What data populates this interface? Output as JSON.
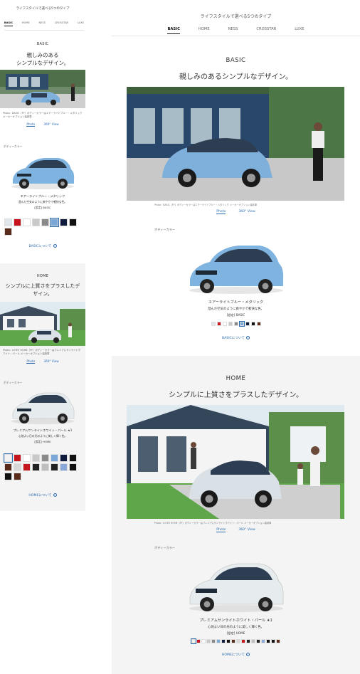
{
  "page_title": "ライフスタイルで選べる5つのタイプ",
  "tabs": [
    "BASIC",
    "HOME",
    "NESS",
    "CROSSTAR",
    "LUXE"
  ],
  "active_tab": "BASIC",
  "basic": {
    "type_label": "BASIC",
    "headline_mobile_line1": "親しみのある",
    "headline_mobile_line2": "シンプルなデザイン。",
    "headline": "親しみのあるシンプルなデザイン。",
    "photo_caption": "Photo：BASIC（FF）ボディーカラーはエアーライトブルー・メタリック メーカーオプション装着車",
    "link_photo": "Photo",
    "link_360": "360° View",
    "body_color_label": "ボディーカラー",
    "color_name": "エアーライトブルー・メタリック",
    "color_desc": "澄んだ空気のように爽やかで軽快な色。",
    "color_type": "[設定] BASIC",
    "more_link": "BASICについて",
    "swatches_mobile": [
      "#dfe6ec",
      "#c4161c",
      "#ffffff",
      "#c9c9c9",
      "#8a8a8a",
      "#7aa7d6",
      "#0e1b3d",
      "#111111",
      "#5a2a1a"
    ],
    "swatches_desktop": [
      "#dfe6ec",
      "#c4161c",
      "#ffffff",
      "#c9c9c9",
      "#8a8a8a",
      "#7aa7d6",
      "#0e1b3d",
      "#111111",
      "#5a2a1a"
    ],
    "selected_swatch": 5,
    "accent": "#2b6cb0"
  },
  "home": {
    "type_label": "HOME",
    "headline_mobile_line1": "シンプルに上質さをプラスしたデ",
    "headline_mobile_line2": "ザイン。",
    "headline": "シンプルに上質さをプラスしたデザイン。",
    "photo_caption": "Photo：e:HEV HOME（FF）ボディーカラーはプレミアムサンライトホワイト・パール メーカーオプション装着車",
    "link_photo": "Photo",
    "link_360": "360° View",
    "body_color_label": "ボディーカラー",
    "color_name": "プレミアムサンライトホワイト・パール ★1",
    "color_desc": "心地よい日の光のように美しく輝く色。",
    "color_type": "[設定] HOME",
    "more_link": "HOMEについて",
    "swatches_mobile": [
      "#f2f2f2",
      "#c4161c",
      "#ffffff",
      "#c9c9c9",
      "#8a8a8a",
      "#7aa7d6",
      "#0e1b3d",
      "#111111",
      "#5a2a1a",
      "#d8d8d8",
      "#c4161c",
      "#222222",
      "#bfbfbf",
      "#222222",
      "#8aa8d8",
      "#111111",
      "#111111",
      "#5a2a1a"
    ],
    "swatches_desktop": [
      "#f2f2f2",
      "#c4161c",
      "#ffffff",
      "#c9c9c9",
      "#8a8a8a",
      "#7aa7d6",
      "#0e1b3d",
      "#111111",
      "#5a2a1a",
      "#d8d8d8",
      "#c4161c",
      "#222222",
      "#bfbfbf",
      "#222222",
      "#8aa8d8",
      "#111111",
      "#111111",
      "#5a2a1a"
    ],
    "selected_swatch": 0
  }
}
